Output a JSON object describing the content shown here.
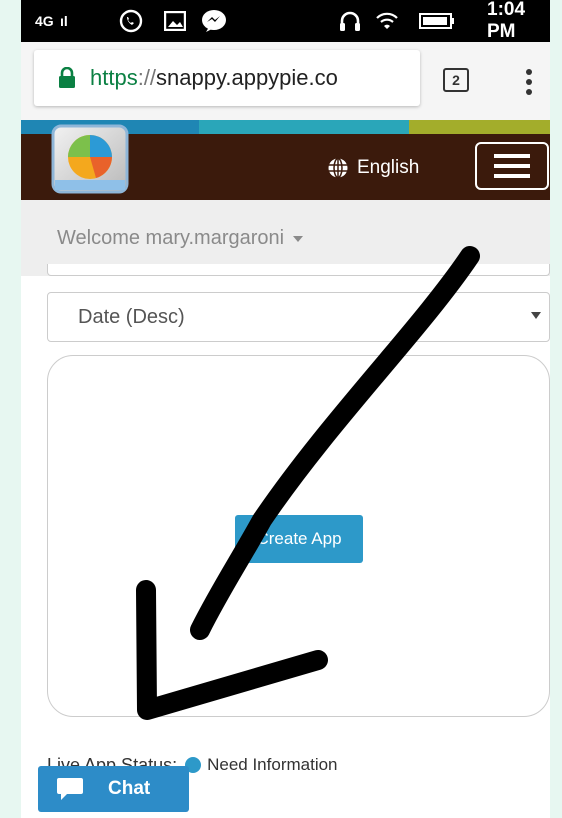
{
  "statusbar": {
    "signal": "4G   ıl",
    "time": "1:04 PM",
    "icons": [
      "whatsapp-icon",
      "gallery-icon",
      "messenger-icon",
      "headset-icon",
      "wifi-icon",
      "battery-icon"
    ]
  },
  "browser": {
    "url_scheme": "https",
    "url_sep": "://",
    "url_host": "snappy.appypie.co",
    "tab_count": "2",
    "icons": [
      "lock-icon",
      "menu-dots-icon"
    ]
  },
  "colors": {
    "header_bg": "#3b1a0c",
    "accent_blue": "#2d99c9",
    "strip": [
      "#1f86b4",
      "#2aa6b9",
      "#a3ad2b"
    ]
  },
  "header": {
    "language": "English",
    "icons": [
      "app-logo",
      "globe-icon",
      "hamburger-icon"
    ]
  },
  "welcome": {
    "text": "Welcome mary.margaroni"
  },
  "sort": {
    "selected": "Date (Desc)"
  },
  "card": {
    "create_app_label": "Create App"
  },
  "status": {
    "label": "Live App Status:",
    "value": "Need Information"
  },
  "chat": {
    "label": "Chat",
    "icon": "chat-bubble-icon"
  }
}
